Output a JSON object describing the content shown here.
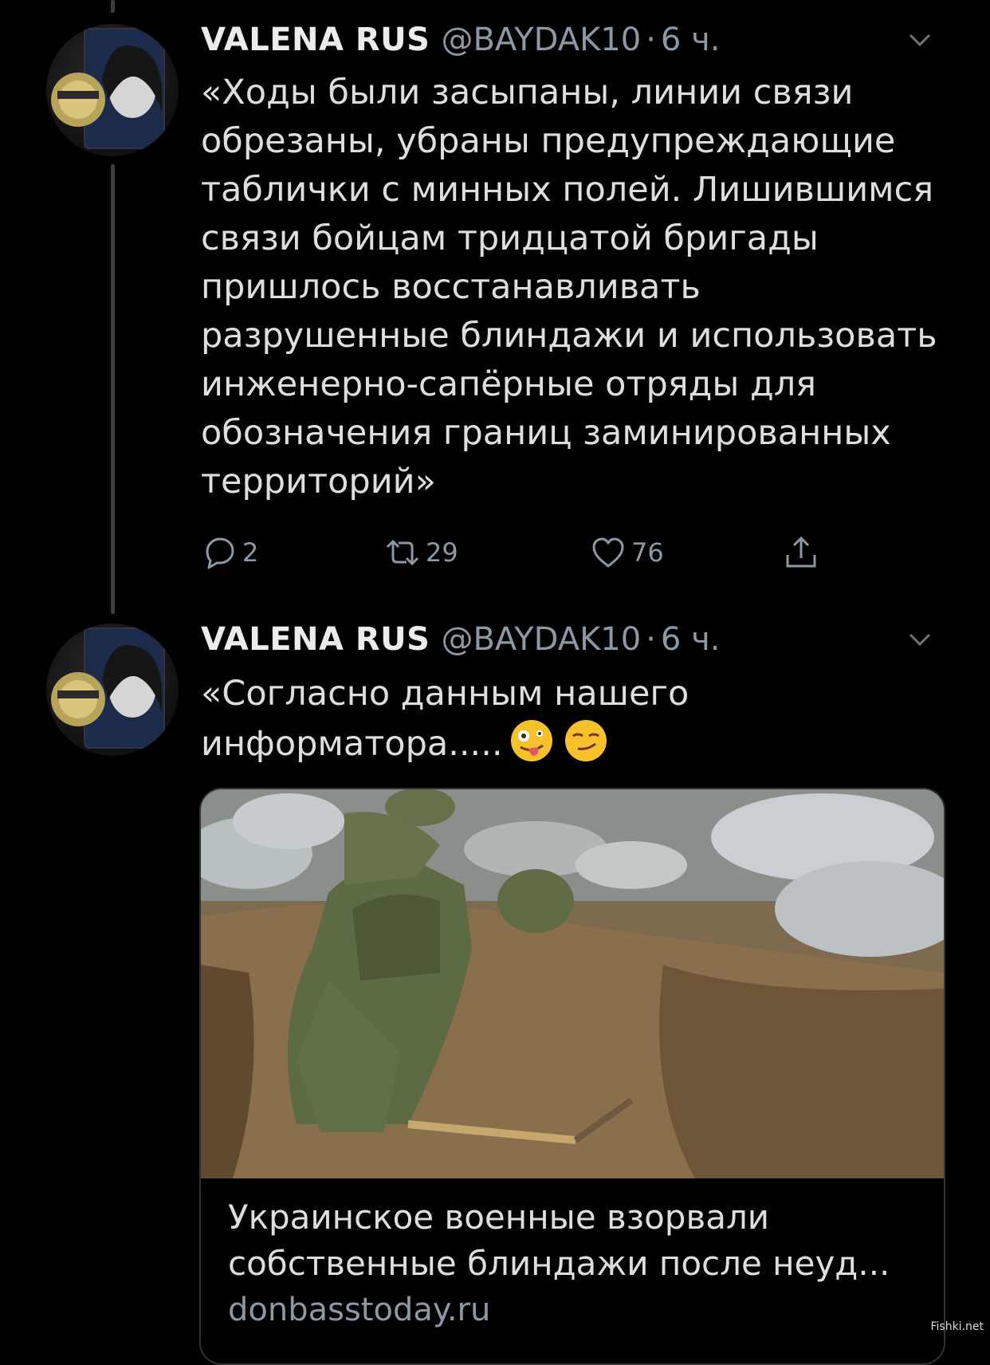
{
  "tweets": [
    {
      "display_name": "VALENA RUS",
      "handle": "@BAYDAK10",
      "separator": "·",
      "time": "6 ч.",
      "text": "«Ходы были засыпаны, линии связи\nобрезаны, убраны предупреждающие\nтаблички с минных полей. Лишившимся\nсвязи бойцам тридцатой бригады\nпришлось восстанавливать\nразрушенные блиндажи и использовать\nинженерно-сапёрные отряды для\nобозначения границ заминированных\nтерриторий»",
      "actions": {
        "reply_count": "2",
        "retweet_count": "29",
        "like_count": "76"
      }
    },
    {
      "display_name": "VALENA RUS",
      "handle": "@BAYDAK10",
      "separator": "·",
      "time": "6 ч.",
      "text": "«Согласно данным нашего\nинформатора.....",
      "emojis": [
        "zany-face",
        "smirking-face"
      ],
      "card": {
        "title": "Украинское военные взорвали\nсобственные блиндажи после неуд...",
        "domain": "donbasstoday.ru"
      }
    }
  ],
  "watermark": "Fishki.net",
  "colors": {
    "background": "#000000",
    "text_primary": "#dedede",
    "text_secondary": "#8b98a5",
    "thread_line": "#3a3d41",
    "card_border": "#2f3336"
  },
  "icons": [
    "reply-icon",
    "retweet-icon",
    "like-icon",
    "share-icon",
    "chevron-down-icon"
  ]
}
